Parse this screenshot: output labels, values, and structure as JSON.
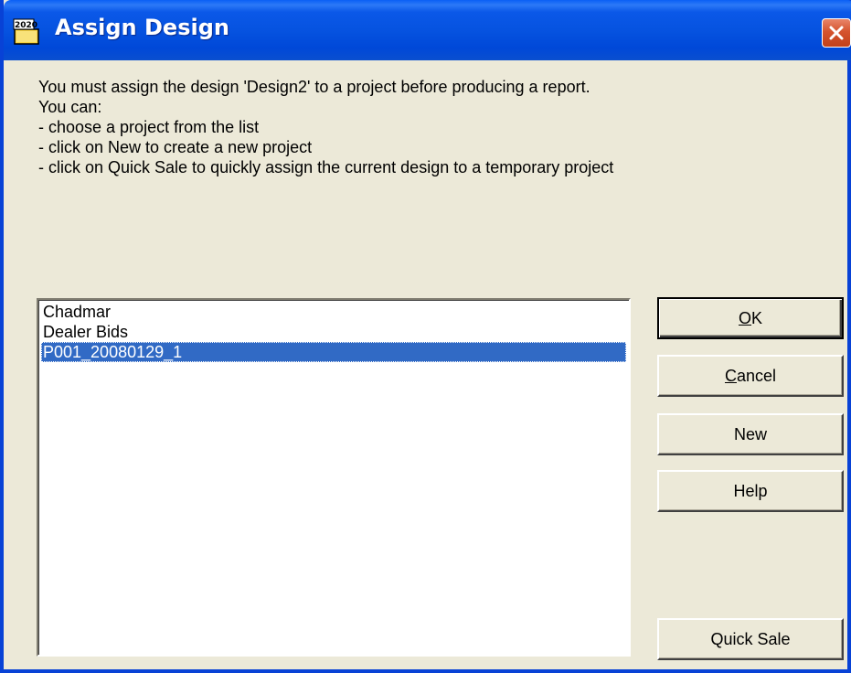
{
  "window": {
    "title": "Assign Design",
    "icon_badge": "2020",
    "icon": "app-icon",
    "close_icon": "close-icon",
    "titlebar_color": "#0653e0",
    "close_color": "#d5542e"
  },
  "message": {
    "lines": [
      "You must assign the design 'Design2' to a project before producing a report.",
      "You can:",
      "- choose a project from the list",
      "- click on New to create a new project",
      "- click on Quick Sale to quickly assign the current design to a temporary project"
    ]
  },
  "projects": {
    "items": [
      "Chadmar",
      "Dealer Bids",
      "P001_20080129_1"
    ],
    "selected": "P001_20080129_1",
    "selection_color": "#316ac5"
  },
  "buttons": {
    "ok": {
      "mnemonic": "O",
      "rest": "K"
    },
    "cancel": {
      "mnemonic": "C",
      "rest": "ancel"
    },
    "new": "New",
    "help": "Help",
    "quick_sale": "Quick Sale"
  }
}
